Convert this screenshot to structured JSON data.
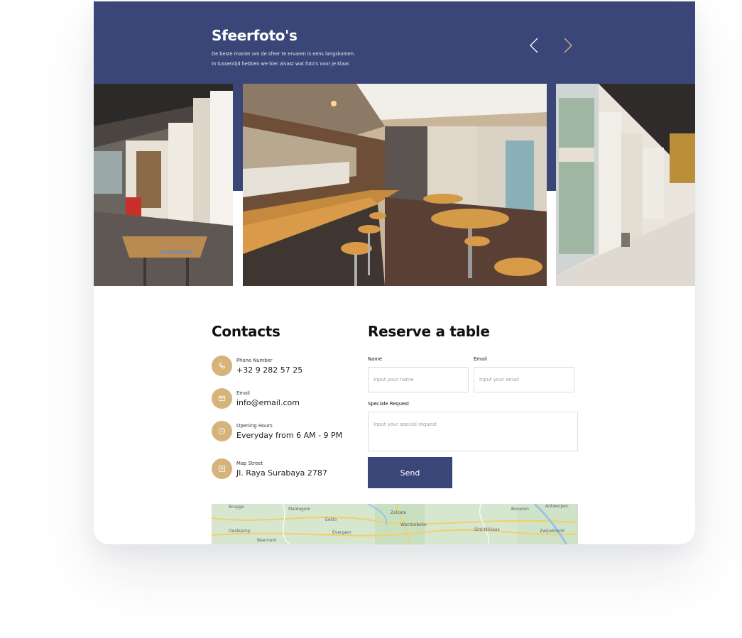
{
  "gallery": {
    "title": "Sfeerfoto's",
    "subtitle_line1": "De beste manier om de sfeer te ervaren is eens langskomen.",
    "subtitle_line2": "In tussentijd hebben we hier alvast wat foto's voor je klaar.",
    "prev_icon": "chevron-left-icon",
    "next_icon": "chevron-right-icon"
  },
  "contacts": {
    "title": "Contacts",
    "items": [
      {
        "icon": "phone-icon",
        "label": "Phone Number",
        "value": "+32 9 282 57 25"
      },
      {
        "icon": "mail-icon",
        "label": "Email",
        "value": "info@email.com"
      },
      {
        "icon": "clock-icon",
        "label": "Opening Hours",
        "value": "Everyday from 6 AM - 9 PM"
      },
      {
        "icon": "map-icon",
        "label": "Map Street",
        "value": "Jl. Raya Surabaya 2787"
      }
    ]
  },
  "reservation": {
    "title": "Reserve a table",
    "name_label": "Name",
    "name_placeholder": "Input your name",
    "email_label": "Email",
    "email_placeholder": "Input your email",
    "request_label": "Speciale Request",
    "request_placeholder": "Input your special request",
    "send_label": "Send"
  },
  "map": {
    "labels": [
      "Brugge",
      "Maldegem",
      "Eeklo",
      "Zelzate",
      "Beveren",
      "Antwerpen",
      "Wachtebeke",
      "Sint-Niklaas",
      "Oostkamp",
      "Beernem",
      "Zwijndrecht",
      "Evergem"
    ]
  },
  "colors": {
    "primary": "#3b4678",
    "accent": "#d6b37a"
  }
}
